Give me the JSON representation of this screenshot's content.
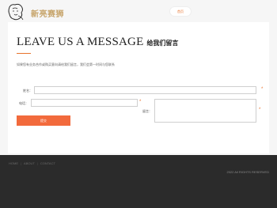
{
  "header": {
    "brand": "新亮赛狮",
    "home_button": "首页"
  },
  "page": {
    "title_en": "LEAVE US A MESSAGE",
    "title_cn": "给我们留言",
    "subtitle": "如果您有业务合作或购买意向请给我们留言，我们会第一时间与您联系"
  },
  "form": {
    "name_label": "姓名：",
    "phone_label": "电话：",
    "message_label": "留言：",
    "required_mark": "*",
    "submit_label": "提交"
  },
  "footer": {
    "nav": [
      "HOME",
      "ABOUT",
      "CONTACT"
    ],
    "separator": "|",
    "copyright": "2022 All RIGHTS RESERVED"
  },
  "colors": {
    "accent": "#f26a3c",
    "brand_gold": "#c7a56c",
    "footer_bg": "#2b2b2b"
  }
}
